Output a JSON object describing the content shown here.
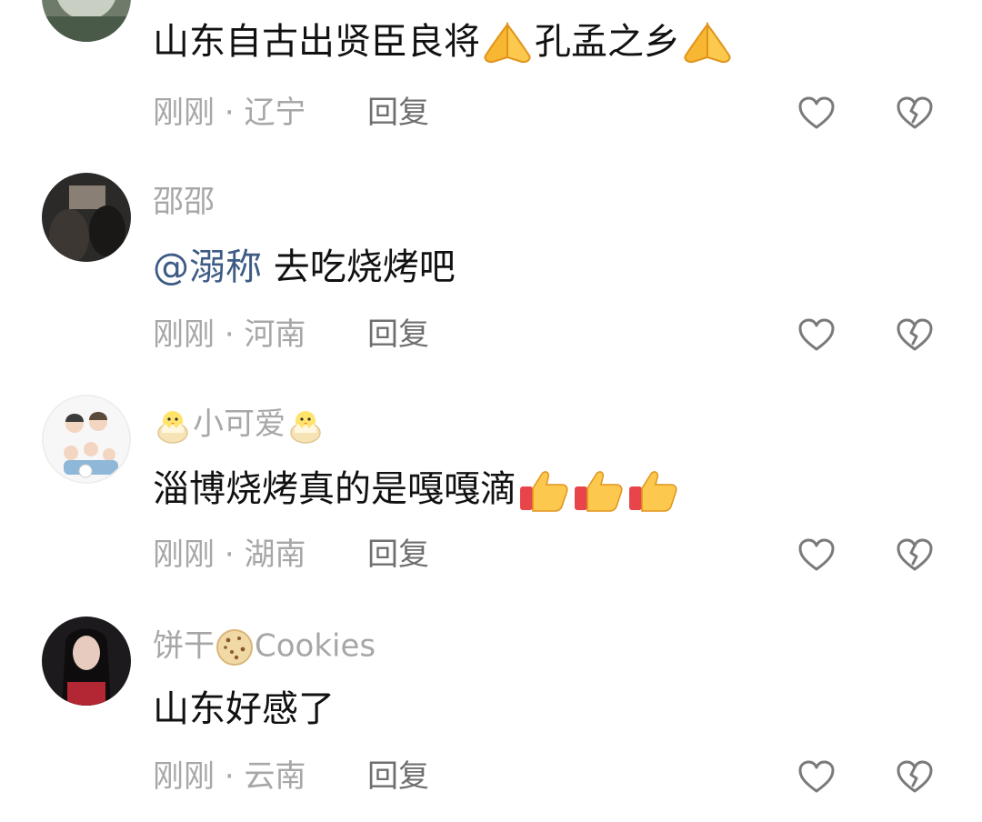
{
  "comments": [
    {
      "username": "",
      "text": "山东自古出贤臣良将",
      "text_after": "孔孟之乡",
      "emoji": "pray",
      "time": "刚刚",
      "sep": "·",
      "location": "辽宁",
      "reply": "回复"
    },
    {
      "username": "邵邵",
      "mention": "@溺称",
      "text": " 去吃烧烤吧",
      "time": "刚刚",
      "sep": "·",
      "location": "河南",
      "reply": "回复"
    },
    {
      "username": "小可爱",
      "emoji": "chick",
      "text": "淄博烧烤真的是嘎嘎滴",
      "emoji_after": "thumbs-up",
      "time": "刚刚",
      "sep": "·",
      "location": "湖南",
      "reply": "回复"
    },
    {
      "username": "饼干",
      "username_suffix": "Cookies",
      "emoji": "cookie",
      "text": "山东好感了",
      "time": "刚刚",
      "sep": "·",
      "location": "云南",
      "reply": "回复"
    }
  ],
  "colors": {
    "text": "#111111",
    "meta": "#a7a7a7",
    "mention": "#3d5b84",
    "icon": "#7a7a7a"
  },
  "icons": [
    "heart-outline-icon",
    "broken-heart-icon",
    "pray-emoji",
    "chick-emoji",
    "thumbs-up-emoji",
    "cookie-emoji"
  ]
}
